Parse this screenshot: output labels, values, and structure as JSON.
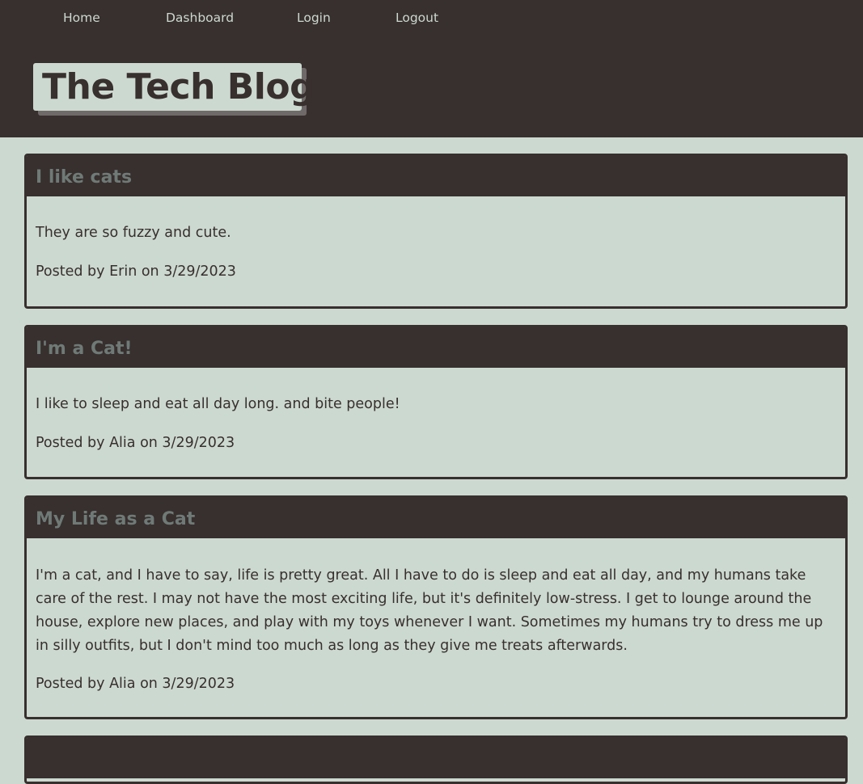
{
  "nav": {
    "home": "Home",
    "dashboard": "Dashboard",
    "login": "Login",
    "logout": "Logout"
  },
  "site_title": "The Tech Blog",
  "posts": [
    {
      "title": "I like cats",
      "content": "They are so fuzzy and cute.",
      "meta": "Posted by Erin on 3/29/2023"
    },
    {
      "title": "I'm a Cat!",
      "content": "I like to sleep and eat all day long. and bite people!",
      "meta": "Posted by Alia on 3/29/2023"
    },
    {
      "title": "My Life as a Cat",
      "content": "I'm a cat, and I have to say, life is pretty great. All I have to do is sleep and eat all day, and my humans take care of the rest. I may not have the most exciting life, but it's definitely low-stress. I get to lounge around the house, explore new places, and play with my toys whenever I want. Sometimes my humans try to dress me up in silly outfits, but I don't mind too much as long as they give me treats afterwards.",
      "meta": "Posted by Alia on 3/29/2023"
    }
  ],
  "colors": {
    "header_bg": "#382f2f",
    "page_bg": "#ccd9d0",
    "post_title": "#6f7a76"
  }
}
